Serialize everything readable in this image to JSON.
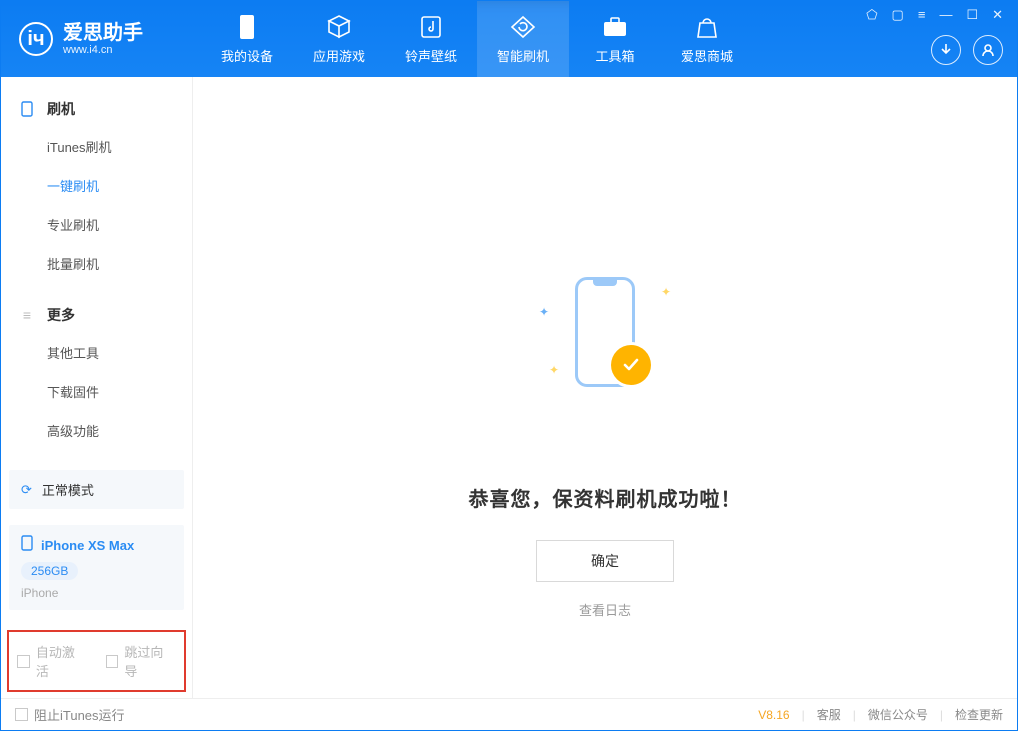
{
  "logo": {
    "title": "爱思助手",
    "subtitle": "www.i4.cn"
  },
  "nav": {
    "items": [
      {
        "label": "我的设备",
        "icon": "device"
      },
      {
        "label": "应用游戏",
        "icon": "cube"
      },
      {
        "label": "铃声壁纸",
        "icon": "music"
      },
      {
        "label": "智能刷机",
        "icon": "refresh",
        "active": true
      },
      {
        "label": "工具箱",
        "icon": "toolbox"
      },
      {
        "label": "爱思商城",
        "icon": "bag"
      }
    ]
  },
  "sidebar": {
    "group1": {
      "title": "刷机",
      "items": [
        "iTunes刷机",
        "一键刷机",
        "专业刷机",
        "批量刷机"
      ],
      "activeIndex": 1
    },
    "group2": {
      "title": "更多",
      "items": [
        "其他工具",
        "下载固件",
        "高级功能"
      ]
    },
    "mode": "正常模式",
    "device": {
      "name": "iPhone XS Max",
      "capacity": "256GB",
      "type": "iPhone"
    },
    "options": {
      "autoActivate": "自动激活",
      "skipGuide": "跳过向导"
    }
  },
  "main": {
    "success": "恭喜您，保资料刷机成功啦！",
    "ok": "确定",
    "viewLog": "查看日志"
  },
  "footer": {
    "blockItunes": "阻止iTunes运行",
    "version": "V8.16",
    "links": [
      "客服",
      "微信公众号",
      "检查更新"
    ]
  }
}
